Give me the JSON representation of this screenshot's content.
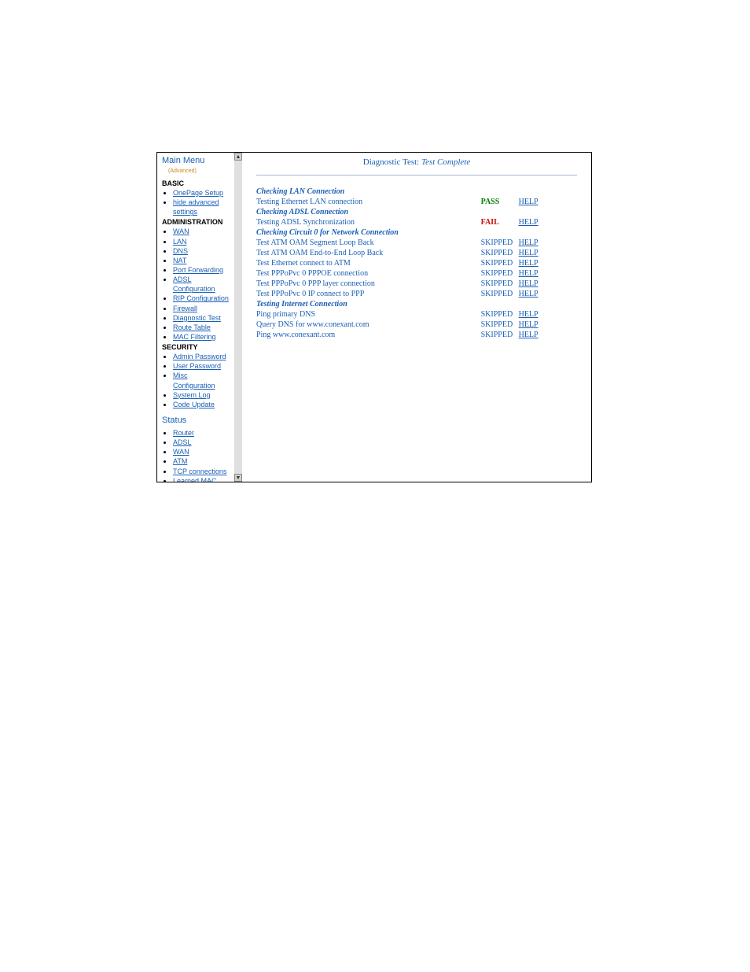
{
  "sidebar": {
    "title": "Main Menu",
    "advanced": "(Advanced)",
    "sections": [
      {
        "header": "BASIC",
        "items": [
          "OnePage Setup",
          "hide advanced settings"
        ]
      },
      {
        "header": "ADMINISTRATION",
        "items": [
          "WAN",
          "LAN",
          "DNS",
          "NAT",
          "Port Forwarding",
          "ADSL Configuration",
          "RIP Configuration",
          "Firewall",
          "Diagnostic Test",
          "Route Table",
          "MAC Filtering"
        ]
      },
      {
        "header": "SECURITY",
        "items": [
          "Admin Password",
          "User Password",
          "Misc Configuration",
          "System Log",
          "Code Update"
        ]
      }
    ],
    "status_header": "Status",
    "status_items": [
      "Router",
      "ADSL",
      "WAN",
      "ATM",
      "TCP connections",
      "Learned MAC Table"
    ]
  },
  "content": {
    "title_prefix": "Diagnostic Test:",
    "title_status": "Test Complete",
    "help_label": "HELP",
    "groups": [
      {
        "header": "Checking LAN Connection",
        "rows": [
          {
            "label": "Testing Ethernet LAN connection",
            "status": "PASS",
            "cls": "pass"
          }
        ]
      },
      {
        "header": "Checking ADSL Connection",
        "rows": [
          {
            "label": "Testing ADSL Synchronization",
            "status": "FAIL",
            "cls": "fail"
          }
        ]
      },
      {
        "header": "Checking Circuit 0 for Network Connection",
        "rows": [
          {
            "label": "Test ATM OAM Segment Loop Back",
            "status": "SKIPPED",
            "cls": "skipped"
          },
          {
            "label": "Test ATM OAM End-to-End Loop Back",
            "status": "SKIPPED",
            "cls": "skipped"
          },
          {
            "label": "Test Ethernet connect to ATM",
            "status": "SKIPPED",
            "cls": "skipped"
          },
          {
            "label": "Test PPPoPvc 0 PPPOE connection",
            "status": "SKIPPED",
            "cls": "skipped"
          },
          {
            "label": "Test PPPoPvc 0 PPP layer connection",
            "status": "SKIPPED",
            "cls": "skipped"
          },
          {
            "label": "Test PPPoPvc 0 IP connect to PPP",
            "status": "SKIPPED",
            "cls": "skipped"
          }
        ]
      },
      {
        "header": "Testing Internet Connection",
        "rows": [
          {
            "label": "Ping primary DNS",
            "status": "SKIPPED",
            "cls": "skipped"
          },
          {
            "label": "Query DNS for www.conexant.com",
            "status": "SKIPPED",
            "cls": "skipped"
          },
          {
            "label": "Ping www.conexant.com",
            "status": "SKIPPED",
            "cls": "skipped"
          }
        ]
      }
    ]
  }
}
